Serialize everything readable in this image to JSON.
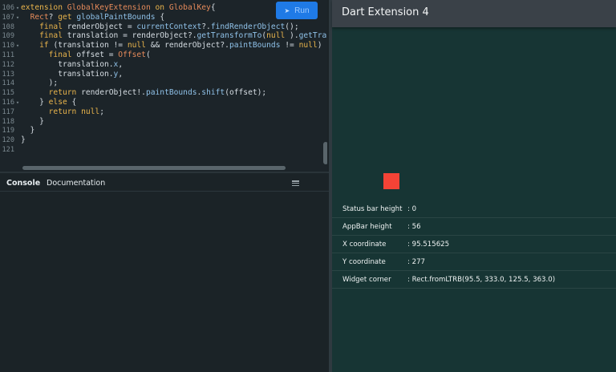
{
  "editor": {
    "run_label": "Run",
    "lines": [
      {
        "n": "106",
        "fold": "▾",
        "tokens": [
          [
            "kw",
            "extension "
          ],
          [
            "ty",
            "GlobalKeyExtension"
          ],
          [
            "kw",
            " on "
          ],
          [
            "ty",
            "GlobalKey"
          ],
          [
            "",
            "{"
          ]
        ]
      },
      {
        "n": "107",
        "fold": "▾",
        "tokens": [
          [
            "",
            "  "
          ],
          [
            "ty",
            "Rect"
          ],
          [
            "",
            "? "
          ],
          [
            "kw",
            "get "
          ],
          [
            "fn",
            "globalPaintBounds"
          ],
          [
            "",
            " {"
          ]
        ]
      },
      {
        "n": "108",
        "fold": "",
        "tokens": [
          [
            "",
            "    "
          ],
          [
            "kw",
            "final "
          ],
          [
            "",
            "renderObject = "
          ],
          [
            "fn",
            "currentContext"
          ],
          [
            "",
            "?."
          ],
          [
            "fn",
            "findRenderObject"
          ],
          [
            "",
            "();"
          ]
        ]
      },
      {
        "n": "109",
        "fold": "",
        "tokens": [
          [
            "",
            "    "
          ],
          [
            "kw",
            "final "
          ],
          [
            "",
            "translation = renderObject?."
          ],
          [
            "fn",
            "getTransformTo"
          ],
          [
            "",
            "("
          ],
          [
            "kw",
            "null"
          ],
          [
            "",
            " )."
          ],
          [
            "fn",
            "getTransla"
          ]
        ]
      },
      {
        "n": "110",
        "fold": "▾",
        "tokens": [
          [
            "",
            "    "
          ],
          [
            "kw",
            "if "
          ],
          [
            "",
            "(translation != "
          ],
          [
            "kw",
            "null "
          ],
          [
            "",
            "&& renderObject?."
          ],
          [
            "fn",
            "paintBounds"
          ],
          [
            "",
            " != "
          ],
          [
            "kw",
            "null"
          ],
          [
            "",
            ") {"
          ]
        ]
      },
      {
        "n": "111",
        "fold": "",
        "tokens": [
          [
            "",
            "      "
          ],
          [
            "kw",
            "final "
          ],
          [
            "",
            "offset = "
          ],
          [
            "ty",
            "Offset"
          ],
          [
            "",
            "("
          ]
        ]
      },
      {
        "n": "112",
        "fold": "",
        "tokens": [
          [
            "",
            "        translation."
          ],
          [
            "fn",
            "x"
          ],
          [
            "",
            ","
          ]
        ]
      },
      {
        "n": "113",
        "fold": "",
        "tokens": [
          [
            "",
            "        translation."
          ],
          [
            "fn",
            "y"
          ],
          [
            "",
            ","
          ]
        ]
      },
      {
        "n": "114",
        "fold": "",
        "tokens": [
          [
            "",
            "      );"
          ]
        ]
      },
      {
        "n": "115",
        "fold": "",
        "tokens": [
          [
            "",
            "      "
          ],
          [
            "kw",
            "return "
          ],
          [
            "",
            "renderObject!."
          ],
          [
            "fn",
            "paintBounds"
          ],
          [
            "",
            "."
          ],
          [
            "fn",
            "shift"
          ],
          [
            "",
            "(offset);"
          ]
        ]
      },
      {
        "n": "116",
        "fold": "▾",
        "tokens": [
          [
            "",
            "    } "
          ],
          [
            "kw",
            "else "
          ],
          [
            "",
            "{"
          ]
        ]
      },
      {
        "n": "117",
        "fold": "",
        "tokens": [
          [
            "",
            "      "
          ],
          [
            "kw",
            "return "
          ],
          [
            "kw",
            "null"
          ],
          [
            "",
            ";"
          ]
        ]
      },
      {
        "n": "118",
        "fold": "",
        "tokens": [
          [
            "",
            "    }"
          ]
        ]
      },
      {
        "n": "119",
        "fold": "",
        "tokens": [
          [
            "",
            "  }"
          ]
        ]
      },
      {
        "n": "120",
        "fold": "",
        "tokens": [
          [
            "",
            "}"
          ]
        ]
      },
      {
        "n": "121",
        "fold": "",
        "tokens": [
          [
            "",
            ""
          ]
        ]
      }
    ]
  },
  "console": {
    "tabs": [
      "Console",
      "Documentation"
    ]
  },
  "app": {
    "title": "Dart Extension 4",
    "box_color": "#f44336",
    "rows": [
      {
        "label": "Status bar height",
        "value": ": 0"
      },
      {
        "label": "AppBar height",
        "value": ": 56"
      },
      {
        "label": "X coordinate",
        "value": ": 95.515625"
      },
      {
        "label": "Y coordinate",
        "value": ": 277"
      },
      {
        "label": "Widget corner",
        "value": ": Rect.fromLTRB(95.5, 333.0, 125.5, 363.0)"
      }
    ]
  }
}
